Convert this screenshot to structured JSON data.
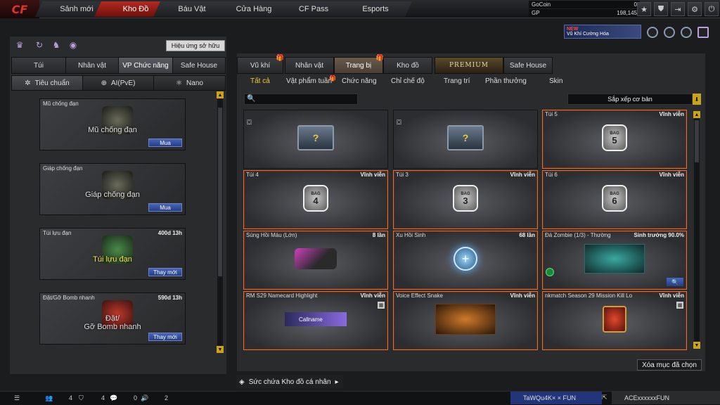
{
  "topnav": {
    "logo": "CF",
    "tabs": [
      {
        "label": "Sảnh mới"
      },
      {
        "label": "Kho Đồ"
      },
      {
        "label": "Báu Vật"
      },
      {
        "label": "Cửa Hàng"
      },
      {
        "label": "CF Pass"
      },
      {
        "label": "Esports"
      }
    ],
    "active_tab": "Kho Đồ",
    "gocoin_label": "GoCoin",
    "gocoin_value": "0",
    "gp_label": "GP",
    "gp_value": "198,145"
  },
  "promo": {
    "badge": "NEW",
    "text": "Vũ Khí Cường Hóa"
  },
  "left": {
    "owned_effects": "Hiệu ứng sở hữu",
    "tabs": [
      {
        "label": "Túi"
      },
      {
        "label": "Nhân vật"
      },
      {
        "label": "VP Chức năng"
      },
      {
        "label": "Safe House"
      }
    ],
    "subtabs": [
      {
        "label": "Tiêu chuẩn"
      },
      {
        "label": "AI(PvE)"
      },
      {
        "label": "Nano"
      }
    ],
    "items": [
      {
        "name": "Mũ chống đạn",
        "big": "Mũ chống đạn",
        "time": "",
        "button": "Mua"
      },
      {
        "name": "Giáp chống đạn",
        "big": "Giáp chống đạn",
        "time": "",
        "button": "Mua"
      },
      {
        "name": "Túi lựu đạn",
        "big": "Túi lựu đạn",
        "time": "400d 13h",
        "button": "Thay mới"
      },
      {
        "name": "Đặt/Gỡ Bomb nhanh",
        "big_line1": "Đặt/",
        "big_line2": "Gỡ Bomb nhanh",
        "time": "590d 13h",
        "button": "Thay mới"
      }
    ]
  },
  "right": {
    "tabs": [
      {
        "label": "Vũ khí"
      },
      {
        "label": "Nhân vật"
      },
      {
        "label": "Trang bị"
      },
      {
        "label": "Kho đồ"
      },
      {
        "label": "PREMIUM"
      },
      {
        "label": "Safe House"
      }
    ],
    "subtabs": [
      {
        "label": "Tất cả"
      },
      {
        "label": "Vật phẩm tuần"
      },
      {
        "label": "Chức năng"
      },
      {
        "label": "Chỉ chế độ"
      },
      {
        "label": "Trang trí"
      },
      {
        "label": "Phần thưởng"
      },
      {
        "label": "Skin"
      }
    ],
    "sort": "Sắp xếp cơ bản",
    "cards": [
      {
        "name": "",
        "dur": "",
        "art": "chest"
      },
      {
        "name": "",
        "dur": "",
        "art": "chest"
      },
      {
        "name": "Túi 5",
        "dur": "Vĩnh viễn",
        "art": "bag",
        "bag": "5"
      },
      {
        "name": "Túi 4",
        "dur": "Vĩnh viễn",
        "art": "bag",
        "bag": "4"
      },
      {
        "name": "Túi 3",
        "dur": "Vĩnh viễn",
        "art": "bag",
        "bag": "3"
      },
      {
        "name": "Túi 6",
        "dur": "Vĩnh viễn",
        "art": "bag",
        "bag": "6"
      },
      {
        "name": "Súng Hồi Máu (Lớn)",
        "dur": "8 lần",
        "art": "gun"
      },
      {
        "name": "Xu Hồi Sinh",
        "dur": "68 lần",
        "art": "coin"
      },
      {
        "name": "Đá Zombie (1/3) - Thường",
        "dur": "Sinh trưởng 90.0%",
        "art": "stone"
      },
      {
        "name": "RM S29 Namecard Highlight",
        "dur": "Vĩnh viễn",
        "art": "namecard",
        "namecard_text": "Callname"
      },
      {
        "name": "Voice Effect Snake",
        "dur": "Vĩnh viễn",
        "art": "snake"
      },
      {
        "name": "nkmatch Season 29 Mission Kill Lo",
        "dur": "Vĩnh viễn",
        "art": "trophy"
      }
    ],
    "delete_btn": "Xóa mục đã chọn",
    "capacity": "Sức chứa Kho đồ cá nhân"
  },
  "bottom": {
    "stat1": "4",
    "stat2": "4",
    "stat3": "0",
    "stat4": "2",
    "friend1": "TaWQu4K×  × FUN",
    "friend2": "ACExxxxxxFUN"
  }
}
